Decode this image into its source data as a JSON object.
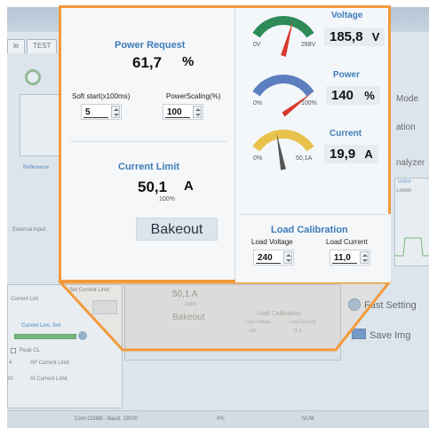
{
  "background_app": {
    "tabs": [
      "le",
      "TEST"
    ],
    "panels": {
      "reference_label": "Reference",
      "external_input_label": "External Input",
      "current_lim_label": "Current Lim",
      "set_current_limit_label": "Set Current Limit",
      "curent_lim_set_label": "Curent Lim. Set",
      "peak_cl_label": "Peak CL",
      "xp_current_limit_label": "XP Current Limit",
      "xi_current_limit_label": "XI Current Limit",
      "xp_value": "4",
      "xi_value": "20",
      "mode_label": "Mode",
      "ation_label": "ation",
      "analyzer_label": "nalyzer",
      "monitor_label": "onitor",
      "monitor_value": "1,66kW",
      "fast_setting_label": "Fast Setting",
      "save_img_label": "Save Img",
      "ghost_current": "50,1 A",
      "ghost_percent": "100%",
      "ghost_bakeout": "Bakeout",
      "ghost_load_title": "Load Calibration",
      "ghost_load_voltage": "Load Voltage",
      "ghost_load_current": "Load Current",
      "ghost_240": "240",
      "ghost_11": "11,0"
    },
    "status_bar": {
      "left": "Com:COM8 - Baud: 19200",
      "mid": "0%",
      "right": "NUM"
    }
  },
  "callout": {
    "power_request": {
      "title": "Power Request",
      "value": "61,7",
      "unit": "%"
    },
    "soft_start": {
      "label": "Soft start(x100ms)",
      "value": "5"
    },
    "power_scaling": {
      "label": "PowerScaling(%)",
      "value": "100"
    },
    "current_limit": {
      "title": "Current Limit",
      "value": "50,1",
      "unit": "A",
      "percent": "100%"
    },
    "bakeout_label": "Bakeout",
    "gauges": {
      "voltage": {
        "title": "Voltage",
        "value": "185,8",
        "unit": "V",
        "min": "0V",
        "max": "288V",
        "level": 0.645,
        "color": "#2e8b57"
      },
      "power": {
        "title": "Power",
        "value": "140",
        "unit": "%",
        "min": "0%",
        "max": "100%",
        "level": 1.0,
        "color": "#5b7fbf"
      },
      "current": {
        "title": "Current",
        "value": "19,9",
        "unit": "A",
        "min": "0%",
        "max": "50,1A",
        "level": 0.4,
        "color": "#e8c24a"
      }
    },
    "load_calibration": {
      "title": "Load Calibration",
      "voltage_label": "Load Voltage",
      "current_label": "Load Current",
      "voltage_value": "240",
      "current_value": "11,0"
    }
  },
  "colors": {
    "accent_orange": "#f39a3c",
    "title_blue": "#3e7cb9"
  }
}
